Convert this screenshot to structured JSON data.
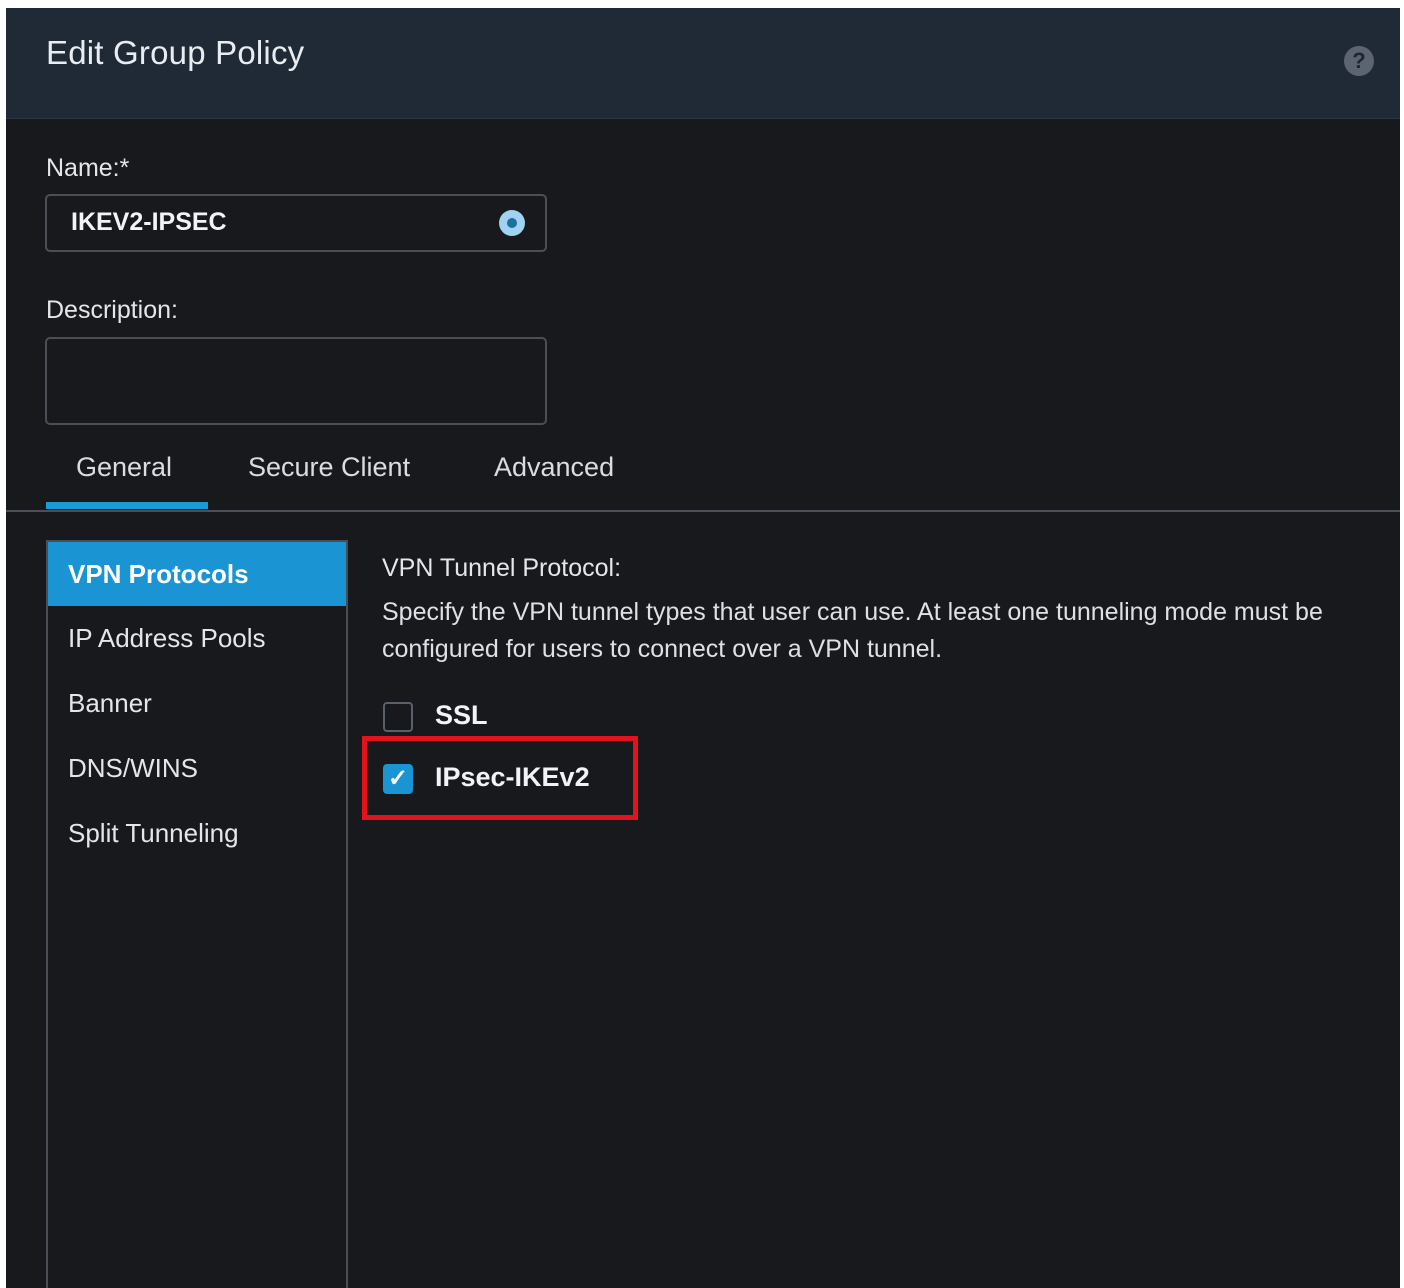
{
  "dialog": {
    "title": "Edit Group Policy",
    "help_icon": "?"
  },
  "form": {
    "name_label": "Name:*",
    "name_value": "IKEV2-IPSEC",
    "description_label": "Description:",
    "description_value": ""
  },
  "tabs": [
    {
      "label": "General",
      "active": true
    },
    {
      "label": "Secure Client",
      "active": false
    },
    {
      "label": "Advanced",
      "active": false
    }
  ],
  "sidebar": {
    "items": [
      {
        "label": "VPN Protocols",
        "active": true
      },
      {
        "label": "IP Address Pools",
        "active": false
      },
      {
        "label": "Banner",
        "active": false
      },
      {
        "label": "DNS/WINS",
        "active": false
      },
      {
        "label": "Split Tunneling",
        "active": false
      }
    ]
  },
  "content": {
    "section_label": "VPN Tunnel Protocol:",
    "description": "Specify the VPN tunnel types that user can use. At least one tunneling mode must be configured for users to connect over a VPN tunnel.",
    "protocols": [
      {
        "label": "SSL",
        "checked": false
      },
      {
        "label": "IPsec-IKEv2",
        "checked": true,
        "check_mark": "✓"
      }
    ]
  },
  "colors": {
    "accent": "#1a94d2",
    "highlight": "#e2131f",
    "header_bg": "#202a37",
    "body_bg": "#17191d"
  }
}
